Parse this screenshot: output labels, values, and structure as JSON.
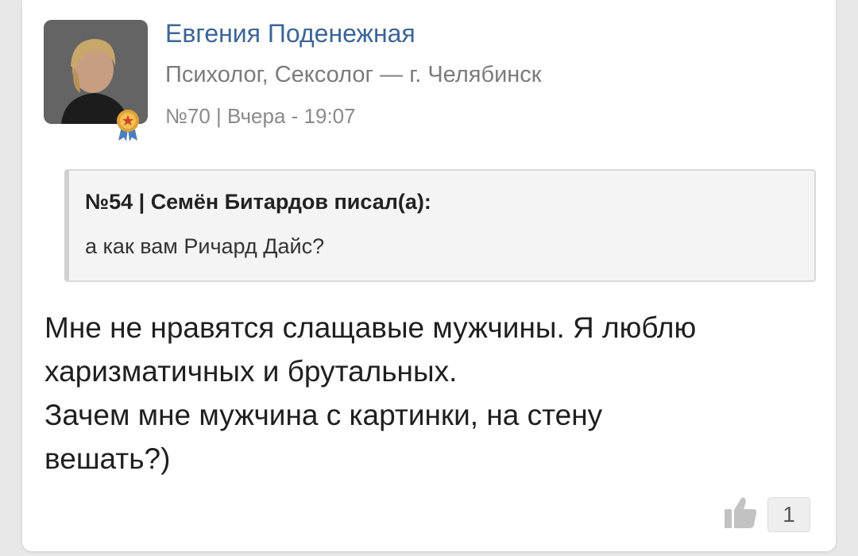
{
  "post": {
    "author_name": "Евгения Поденежная",
    "author_title": "Психолог, Сексолог — г. Челябинск",
    "meta": "№70 | Вчера - 19:07",
    "quote": {
      "header": "№54 | Семён Битардов писал(а):",
      "text": "а как вам Ричард Дайс?"
    },
    "body_lines": [
      "Мне не нравятся слащавые мужчины. Я люблю",
      "харизматичных и брутальных.",
      "Зачем мне мужчина с картинки, на стену",
      "вешать?)"
    ],
    "likes": "1"
  },
  "icons": {
    "avatar": "avatar-photo",
    "badge": "award-medal-icon",
    "like": "thumbs-up-icon"
  },
  "colors": {
    "author_name": "#3c6596",
    "secondary_text": "#7b7b7b",
    "quote_bg": "#f4f4f4"
  }
}
